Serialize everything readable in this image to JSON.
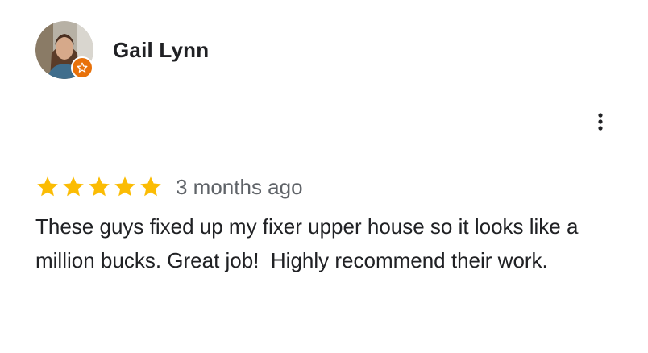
{
  "review": {
    "reviewer_name": "Gail Lynn",
    "avatar_icon": "user-photo-avatar",
    "badge_icon": "local-guide-star-icon",
    "badge_color": "#e8710a",
    "menu_icon": "more-vertical-icon",
    "rating": 5,
    "rating_max": 5,
    "star_color": "#fbbc04",
    "timestamp": "3 months ago",
    "text": "These guys fixed up my fixer upper house so it looks like a million bucks. Great job!  Highly recommend their work."
  }
}
